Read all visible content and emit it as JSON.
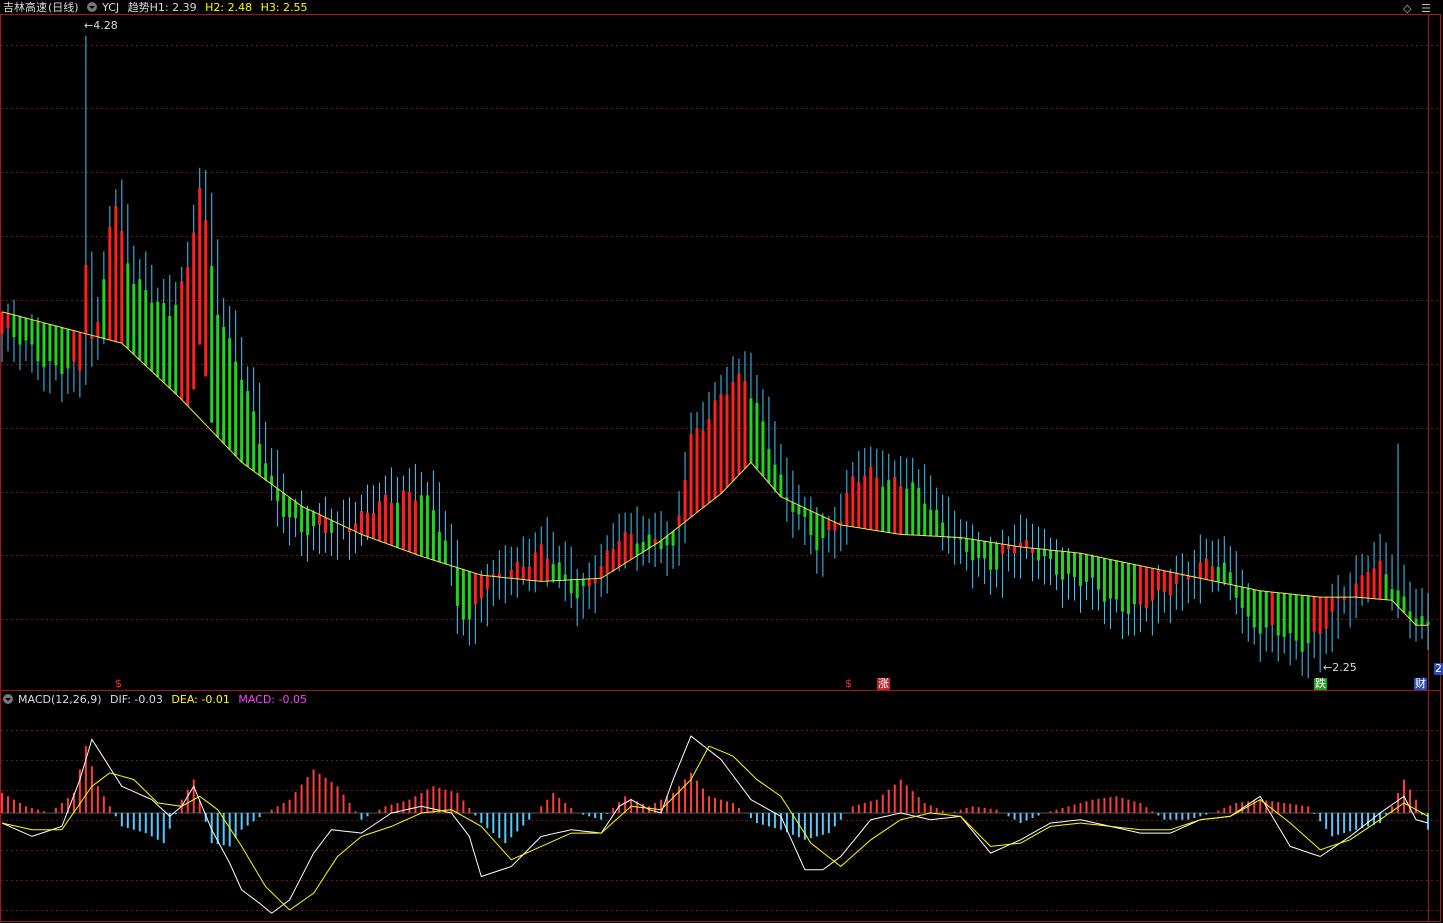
{
  "header": {
    "stock": "吉林高速",
    "period": "(日线)",
    "indicator": "YCJ",
    "h1": "趋势H1: 2.39",
    "h2": "H2: 2.48",
    "h3": "H3: 2.55"
  },
  "window_controls": {
    "diamond": "◇",
    "menu": "☰"
  },
  "annotations": {
    "high_label": "4.28",
    "low_label": "2.25",
    "edge_label": "2"
  },
  "event_markers": [
    {
      "label": "$",
      "color": "#ff3030",
      "boxed": false
    },
    {
      "label": "$",
      "color": "#ff3030",
      "boxed": false
    },
    {
      "label": "涨",
      "color": "#ffffff",
      "bg": "#c0202a",
      "boxed": true
    },
    {
      "label": "跌",
      "color": "#ffffff",
      "bg": "#2a9a2a",
      "boxed": true
    },
    {
      "label": "财",
      "color": "#ffffff",
      "bg": "#2a4ab0",
      "boxed": true
    }
  ],
  "macd_header": {
    "name": "MACD(12,26,9)",
    "dif": "DIF: -0.03",
    "dea": "DEA: -0.01",
    "macd": "MACD: -0.05"
  },
  "colors": {
    "up": "#ff2020",
    "down": "#22d422",
    "shadow": "#40c8ff",
    "ma": "#e8e84a",
    "grid": "#7a1414",
    "border": "#a01818",
    "macd_pos": "#ff3c3c",
    "macd_neg": "#55c8ff",
    "dif": "#ffffff",
    "dea": "#ffff00"
  },
  "chart_data": [
    {
      "type": "line",
      "title": "吉林高速 (日线)",
      "xlabel": "",
      "ylabel": "",
      "ylim": [
        2.2,
        4.35
      ],
      "grid": true,
      "series": [
        {
          "name": "price",
          "x": [
            0,
            2,
            5,
            7,
            10,
            13,
            16,
            18,
            19,
            22,
            25,
            28,
            31,
            33,
            36,
            40,
            43,
            46,
            48,
            50,
            53,
            55,
            58,
            61,
            64,
            67,
            70,
            72,
            74,
            76,
            78,
            80,
            82,
            85,
            88,
            90,
            93,
            96,
            100,
            103,
            106,
            109,
            112,
            115,
            118,
            120,
            122,
            124,
            126,
            129,
            131,
            134,
            136,
            138,
            140,
            142,
            145,
            148,
            151,
            154,
            157,
            160,
            163,
            166,
            168,
            170,
            172,
            175,
            178,
            181,
            184,
            187,
            190,
            193,
            196,
            199,
            202,
            205,
            208,
            211,
            214,
            217,
            220,
            222,
            224,
            226,
            228,
            230,
            232,
            234,
            236,
            238
          ],
          "values": [
            3.33,
            3.31,
            3.28,
            3.25,
            3.22,
            3.2,
            3.36,
            3.7,
            3.73,
            3.48,
            3.45,
            3.41,
            3.52,
            3.79,
            3.42,
            3.2,
            2.98,
            2.8,
            2.76,
            2.7,
            2.69,
            2.71,
            2.73,
            2.75,
            2.79,
            2.83,
            2.82,
            2.75,
            2.66,
            2.48,
            2.42,
            2.5,
            2.53,
            2.58,
            2.62,
            2.64,
            2.57,
            2.5,
            2.58,
            2.67,
            2.69,
            2.68,
            2.62,
            3.0,
            3.08,
            3.13,
            3.16,
            3.18,
            3.11,
            2.93,
            2.79,
            2.72,
            2.67,
            2.7,
            2.74,
            2.85,
            2.89,
            2.87,
            2.84,
            2.8,
            2.74,
            2.65,
            2.59,
            2.6,
            2.65,
            2.66,
            2.62,
            2.6,
            2.56,
            2.53,
            2.49,
            2.47,
            2.45,
            2.48,
            2.54,
            2.58,
            2.59,
            2.57,
            2.42,
            2.37,
            2.37,
            2.35,
            2.37,
            2.42,
            2.49,
            2.53,
            2.6,
            2.58,
            2.52,
            2.47,
            2.45,
            2.41
          ]
        },
        {
          "name": "ma",
          "x": [
            0,
            10,
            20,
            30,
            40,
            50,
            60,
            70,
            80,
            90,
            100,
            110,
            120,
            125,
            130,
            140,
            150,
            160,
            170,
            180,
            190,
            200,
            210,
            220,
            226,
            232,
            236
          ],
          "values": [
            3.4,
            3.35,
            3.3,
            3.12,
            2.92,
            2.78,
            2.69,
            2.62,
            2.56,
            2.54,
            2.55,
            2.67,
            2.82,
            2.92,
            2.81,
            2.72,
            2.69,
            2.68,
            2.65,
            2.63,
            2.59,
            2.55,
            2.51,
            2.49,
            2.49,
            2.48,
            2.4
          ]
        }
      ],
      "annotations": [
        {
          "text": "4.28",
          "x": 14,
          "y": 4.28
        },
        {
          "text": "2.25",
          "x": 220,
          "y": 2.25
        }
      ]
    },
    {
      "type": "bar",
      "title": "MACD(12,26,9)",
      "xlabel": "",
      "ylabel": "",
      "ylim": [
        -0.32,
        0.32
      ],
      "grid": true,
      "series": [
        {
          "name": "DIF",
          "x": [
            0,
            5,
            10,
            13,
            15,
            20,
            25,
            28,
            30,
            32,
            35,
            38,
            40,
            43,
            45,
            48,
            52,
            55,
            60,
            65,
            70,
            75,
            78,
            80,
            85,
            90,
            95,
            100,
            103,
            105,
            108,
            110,
            112,
            115,
            120,
            125,
            130,
            134,
            137,
            140,
            145,
            150,
            155,
            160,
            165,
            170,
            175,
            180,
            185,
            190,
            195,
            200,
            205,
            210,
            215,
            220,
            225,
            230,
            234,
            236,
            238
          ],
          "values": [
            -0.03,
            -0.07,
            -0.04,
            0.1,
            0.22,
            0.08,
            0.04,
            -0.01,
            0.02,
            0.08,
            -0.05,
            -0.15,
            -0.23,
            -0.27,
            -0.3,
            -0.26,
            -0.12,
            -0.05,
            -0.06,
            0.0,
            0.02,
            0.0,
            -0.07,
            -0.19,
            -0.16,
            -0.07,
            -0.05,
            -0.06,
            0.02,
            0.04,
            0.01,
            0.0,
            0.1,
            0.23,
            0.16,
            0.04,
            -0.01,
            -0.17,
            -0.17,
            -0.13,
            -0.02,
            0.0,
            -0.02,
            -0.01,
            -0.12,
            -0.08,
            -0.03,
            -0.02,
            -0.04,
            -0.06,
            -0.06,
            -0.02,
            -0.01,
            0.05,
            -0.1,
            -0.13,
            -0.07,
            0.0,
            0.05,
            -0.02,
            -0.03
          ]
        },
        {
          "name": "DEA",
          "x": [
            0,
            5,
            10,
            15,
            18,
            22,
            26,
            30,
            33,
            36,
            40,
            44,
            48,
            52,
            56,
            60,
            65,
            70,
            75,
            80,
            85,
            90,
            95,
            100,
            105,
            110,
            115,
            118,
            122,
            126,
            130,
            135,
            140,
            145,
            150,
            155,
            160,
            165,
            170,
            175,
            180,
            185,
            190,
            195,
            200,
            205,
            210,
            215,
            220,
            225,
            230,
            234,
            236,
            238
          ],
          "values": [
            -0.03,
            -0.05,
            -0.05,
            0.08,
            0.12,
            0.1,
            0.03,
            0.02,
            0.05,
            0.01,
            -0.1,
            -0.22,
            -0.29,
            -0.24,
            -0.13,
            -0.07,
            -0.04,
            0.0,
            0.01,
            -0.04,
            -0.14,
            -0.1,
            -0.06,
            -0.06,
            0.02,
            0.01,
            0.1,
            0.2,
            0.17,
            0.1,
            0.05,
            -0.09,
            -0.16,
            -0.08,
            -0.02,
            0.0,
            -0.01,
            -0.1,
            -0.09,
            -0.04,
            -0.03,
            -0.04,
            -0.05,
            -0.05,
            -0.02,
            -0.01,
            0.04,
            -0.03,
            -0.11,
            -0.08,
            -0.02,
            0.03,
            0.01,
            -0.01
          ]
        },
        {
          "name": "MACD",
          "x": [
            0,
            4,
            8,
            12,
            14,
            16,
            20,
            24,
            27,
            30,
            32,
            35,
            38,
            40,
            44,
            48,
            52,
            56,
            60,
            64,
            68,
            72,
            76,
            80,
            84,
            88,
            92,
            96,
            100,
            104,
            108,
            112,
            115,
            118,
            122,
            126,
            130,
            134,
            138,
            142,
            146,
            150,
            154,
            158,
            162,
            166,
            170,
            174,
            178,
            182,
            186,
            190,
            194,
            198,
            202,
            206,
            210,
            214,
            218,
            222,
            226,
            230,
            232,
            234,
            236,
            238
          ],
          "values": [
            0.06,
            0.02,
            0.0,
            0.06,
            0.2,
            0.08,
            -0.04,
            -0.06,
            -0.09,
            0.04,
            0.1,
            -0.09,
            -0.1,
            -0.05,
            0.0,
            0.04,
            0.13,
            0.08,
            -0.02,
            0.02,
            0.04,
            0.08,
            0.06,
            -0.03,
            -0.09,
            -0.02,
            0.06,
            0.0,
            -0.02,
            0.05,
            0.02,
            0.06,
            0.12,
            0.05,
            0.03,
            -0.03,
            -0.05,
            -0.08,
            -0.06,
            0.02,
            0.04,
            0.1,
            0.03,
            0.0,
            0.02,
            0.01,
            -0.03,
            0.0,
            0.02,
            0.04,
            0.05,
            0.03,
            -0.02,
            -0.02,
            0.0,
            0.03,
            0.04,
            0.03,
            0.02,
            -0.07,
            -0.05,
            -0.03,
            0.02,
            0.1,
            0.04,
            -0.05
          ]
        }
      ]
    }
  ]
}
